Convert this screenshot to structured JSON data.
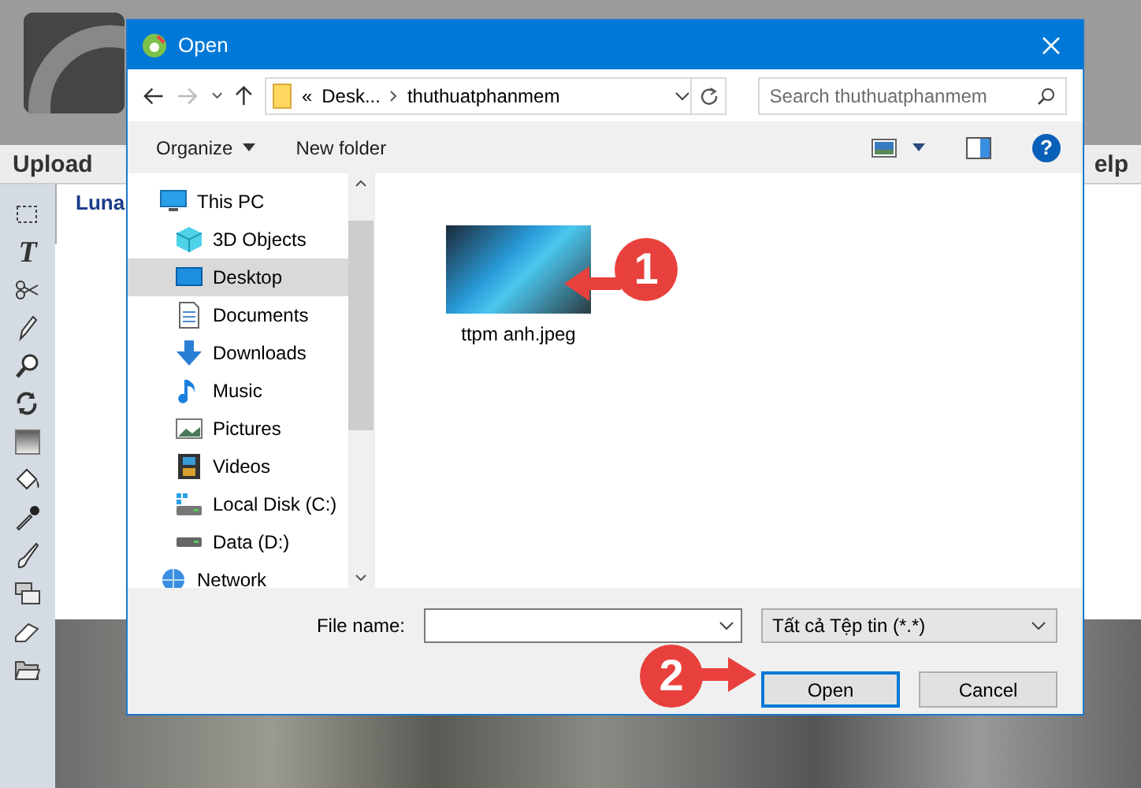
{
  "background_app": {
    "menu": [
      "Upload",
      "elp"
    ],
    "caption": "Luna",
    "tools": [
      {
        "kind": "select"
      },
      {
        "kind": "text",
        "glyph": "T"
      },
      {
        "kind": "cut"
      },
      {
        "kind": "pencil"
      },
      {
        "kind": "zoom"
      },
      {
        "kind": "rotate"
      },
      {
        "kind": "gradient"
      },
      {
        "kind": "fill"
      },
      {
        "kind": "picker"
      },
      {
        "kind": "brush"
      },
      {
        "kind": "layers"
      },
      {
        "kind": "eraser"
      },
      {
        "kind": "open"
      }
    ]
  },
  "dialog": {
    "title": "Open",
    "address": {
      "overflow": "«",
      "segments": [
        "Desk...",
        "thuthuatphanmem"
      ]
    },
    "search": {
      "placeholder": "Search thuthuatphanmem"
    },
    "toolbar": [
      "Organize",
      "New folder"
    ],
    "nav": [
      {
        "label": "This PC",
        "kind": "pc",
        "selected": false,
        "children": [
          {
            "label": "3D Objects",
            "kind": "objects",
            "selected": false
          },
          {
            "label": "Desktop",
            "kind": "desktop",
            "selected": true
          },
          {
            "label": "Documents",
            "kind": "documents",
            "selected": false
          },
          {
            "label": "Downloads",
            "kind": "downloads",
            "selected": false
          },
          {
            "label": "Music",
            "kind": "music",
            "selected": false
          },
          {
            "label": "Pictures",
            "kind": "pictures",
            "selected": false
          },
          {
            "label": "Videos",
            "kind": "videos",
            "selected": false
          },
          {
            "label": "Local Disk (C:)",
            "kind": "disk",
            "selected": false
          },
          {
            "label": "Data (D:)",
            "kind": "drive",
            "selected": false
          }
        ]
      },
      {
        "label": "Network",
        "kind": "network",
        "selected": false
      }
    ],
    "files": [
      {
        "name": "ttpm anh.jpeg",
        "selected": false
      }
    ],
    "help_glyph": "?",
    "file_name": {
      "label": "File name:"
    },
    "file_type": "Tất cả Tệp tin (*.*)",
    "buttons": [
      {
        "label": "Open",
        "default": true
      },
      {
        "label": "Cancel",
        "default": false
      }
    ]
  },
  "annotations": [
    {
      "number": "1"
    },
    {
      "number": "2"
    }
  ]
}
